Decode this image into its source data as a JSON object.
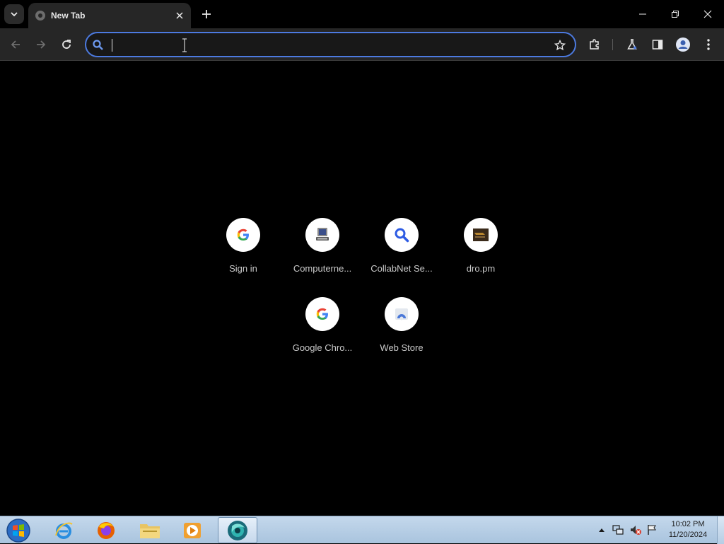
{
  "browser": {
    "tab": {
      "title": "New Tab"
    },
    "omnibox": {
      "value": "",
      "placeholder": ""
    }
  },
  "colors": {
    "accent": "#4c7ae0",
    "toolbar": "#262626",
    "page_bg": "#000000"
  },
  "shortcuts": [
    {
      "label": "Sign in",
      "icon": "google-g-icon"
    },
    {
      "label": "Computerne...",
      "icon": "computer-icon"
    },
    {
      "label": "CollabNet Se...",
      "icon": "search-icon"
    },
    {
      "label": "dro.pm",
      "icon": "dro-pm-thumbnail-icon"
    },
    {
      "label": "Google Chro...",
      "icon": "google-g-icon"
    },
    {
      "label": "Web Store",
      "icon": "web-store-icon"
    }
  ],
  "taskbar": {
    "apps": [
      {
        "name": "internet-explorer",
        "icon": "ie-icon"
      },
      {
        "name": "firefox",
        "icon": "firefox-icon"
      },
      {
        "name": "file-explorer",
        "icon": "folder-icon"
      },
      {
        "name": "media-player",
        "icon": "media-player-icon"
      },
      {
        "name": "chrome-beta",
        "icon": "chrome-icon"
      }
    ],
    "clock": {
      "time": "10:02 PM",
      "date": "11/20/2024"
    }
  }
}
